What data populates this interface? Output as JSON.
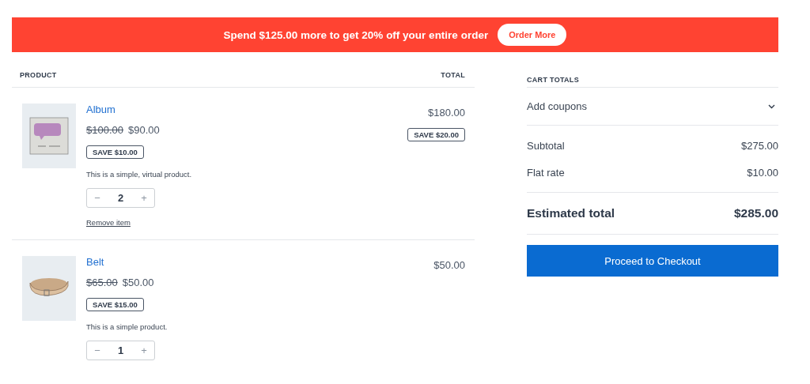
{
  "banner": {
    "message": "Spend $125.00 more to get 20% off your entire order",
    "button": "Order More"
  },
  "cart": {
    "columns": [
      "PRODUCT",
      "TOTAL"
    ],
    "items": [
      {
        "name": "Album",
        "kind": "picture",
        "regular_price": "$100.00",
        "price": "$90.00",
        "save": "SAVE $10.00",
        "description": "This is a simple, virtual product.",
        "quantity": "2",
        "minus": "−",
        "plus": "+",
        "total": "$180.00",
        "total_save": "SAVE $20.00",
        "remove": "Remove item"
      },
      {
        "name": "Belt",
        "kind": "picture",
        "regular_price": "$65.00",
        "price": "$50.00",
        "save": "SAVE $15.00",
        "description": "This is a simple product.",
        "quantity": "1",
        "minus": "−",
        "plus": "+",
        "total": "$50.00"
      }
    ]
  },
  "totals": {
    "title": "CART TOTALS",
    "coupons": {
      "label": "Add coupons",
      "expanded": false
    },
    "lines": [
      {
        "label": "Subtotal",
        "value": "$275.00"
      },
      {
        "label": "Flat rate",
        "value": "$10.00"
      }
    ],
    "estimated": {
      "label": "Estimated total",
      "value": "$285.00"
    },
    "checkout": "Proceed to Checkout"
  }
}
